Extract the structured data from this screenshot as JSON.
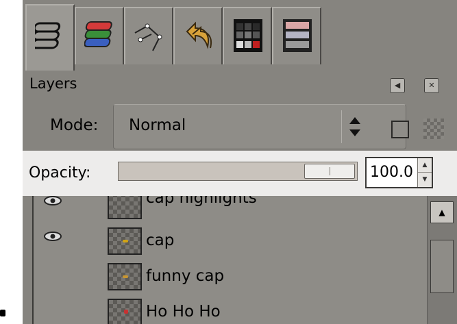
{
  "tabs": [
    {
      "name": "layers-icon",
      "active": true
    },
    {
      "name": "channels-icon",
      "active": false
    },
    {
      "name": "paths-icon",
      "active": false
    },
    {
      "name": "undo-history-icon",
      "active": false
    },
    {
      "name": "colormap-icon",
      "active": false
    },
    {
      "name": "histogram-icon",
      "active": false
    }
  ],
  "panel": {
    "title": "Layers",
    "configure_icon": "left-arrow-icon",
    "close_icon": "close-icon"
  },
  "mode": {
    "label": "Mode:",
    "value": "Normal"
  },
  "opacity": {
    "label": "Opacity:",
    "value": "100.0",
    "level": 1.0
  },
  "layers": [
    {
      "name": "cap highlights",
      "visible": true,
      "mark_color": "#c8a030"
    },
    {
      "name": "cap",
      "visible": true,
      "mark_color": "#d2a414"
    },
    {
      "name": "funny cap",
      "visible": false,
      "mark_color": "#c89632"
    },
    {
      "name": "Ho Ho Ho",
      "visible": false,
      "mark_color": "#c83232"
    }
  ]
}
